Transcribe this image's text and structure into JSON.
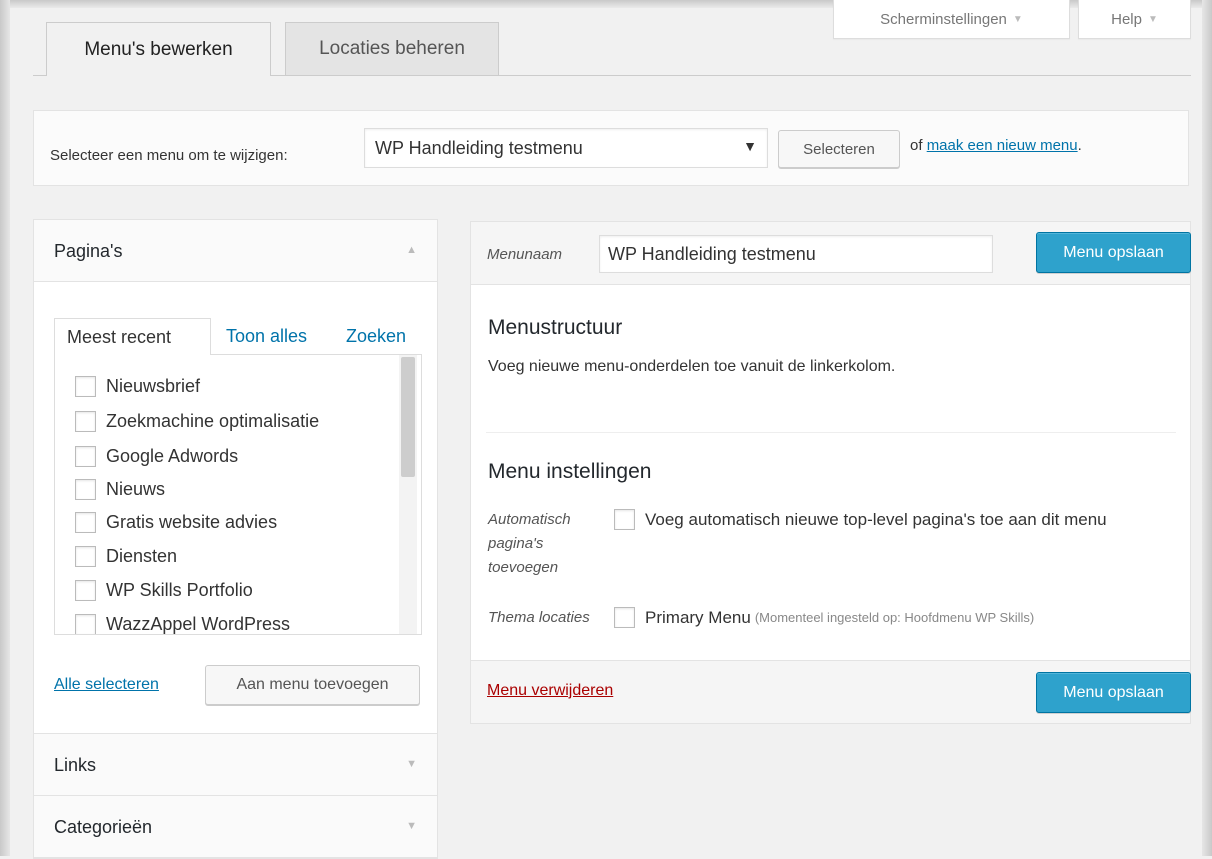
{
  "screen_meta": {
    "screen_options_label": "Scherminstellingen",
    "help_label": "Help"
  },
  "tabs": [
    {
      "label": "Menu's bewerken",
      "active": true
    },
    {
      "label": "Locaties beheren",
      "active": false
    }
  ],
  "manage": {
    "label": "Selecteer een menu om te wijzigen:",
    "selected_menu": "WP Handleiding testmenu",
    "select_button": "Selecteren",
    "or_text": "of",
    "new_menu_link": "maak een nieuw menu",
    "period": "."
  },
  "accordion": {
    "sections": [
      {
        "title": "Pagina's",
        "expanded": true
      },
      {
        "title": "Links",
        "expanded": false
      },
      {
        "title": "Categorieën",
        "expanded": false
      }
    ],
    "subtabs": [
      "Meest recent",
      "Toon alles",
      "Zoeken"
    ],
    "pages": [
      "Nieuwsbrief",
      "Zoekmachine optimalisatie",
      "Google Adwords",
      "Nieuws",
      "Gratis website advies",
      "Diensten",
      "WP Skills Portfolio",
      "WazzAppel WordPress"
    ],
    "select_all_link": "Alle selecteren",
    "add_to_menu_button": "Aan menu toevoegen"
  },
  "editor": {
    "menu_name_label": "Menunaam",
    "menu_name_value": "WP Handleiding testmenu",
    "save_button": "Menu opslaan",
    "structure_title": "Menustructuur",
    "structure_desc": "Voeg nieuwe menu-onderdelen toe vanuit de linkerkolom.",
    "settings_title": "Menu instellingen",
    "auto_add_label_1": "Automatisch",
    "auto_add_label_2": "pagina's",
    "auto_add_label_3": "toevoegen",
    "auto_add_option": "Voeg automatisch nieuwe top-level pagina's toe aan dit menu",
    "theme_locations_label": "Thema locaties",
    "primary_menu_option": "Primary Menu",
    "primary_menu_note": "(Momenteel ingesteld op: Hoofdmenu WP Skills)",
    "delete_link": "Menu verwijderen"
  },
  "colors": {
    "primary_button": "#2ea2cc",
    "link": "#0073aa",
    "delete_link": "#aa0000",
    "background": "#f1f1f1"
  },
  "icons": {
    "dropdown_caret": "▼",
    "collapse_arrow": "▲",
    "expand_arrow": "▼"
  }
}
